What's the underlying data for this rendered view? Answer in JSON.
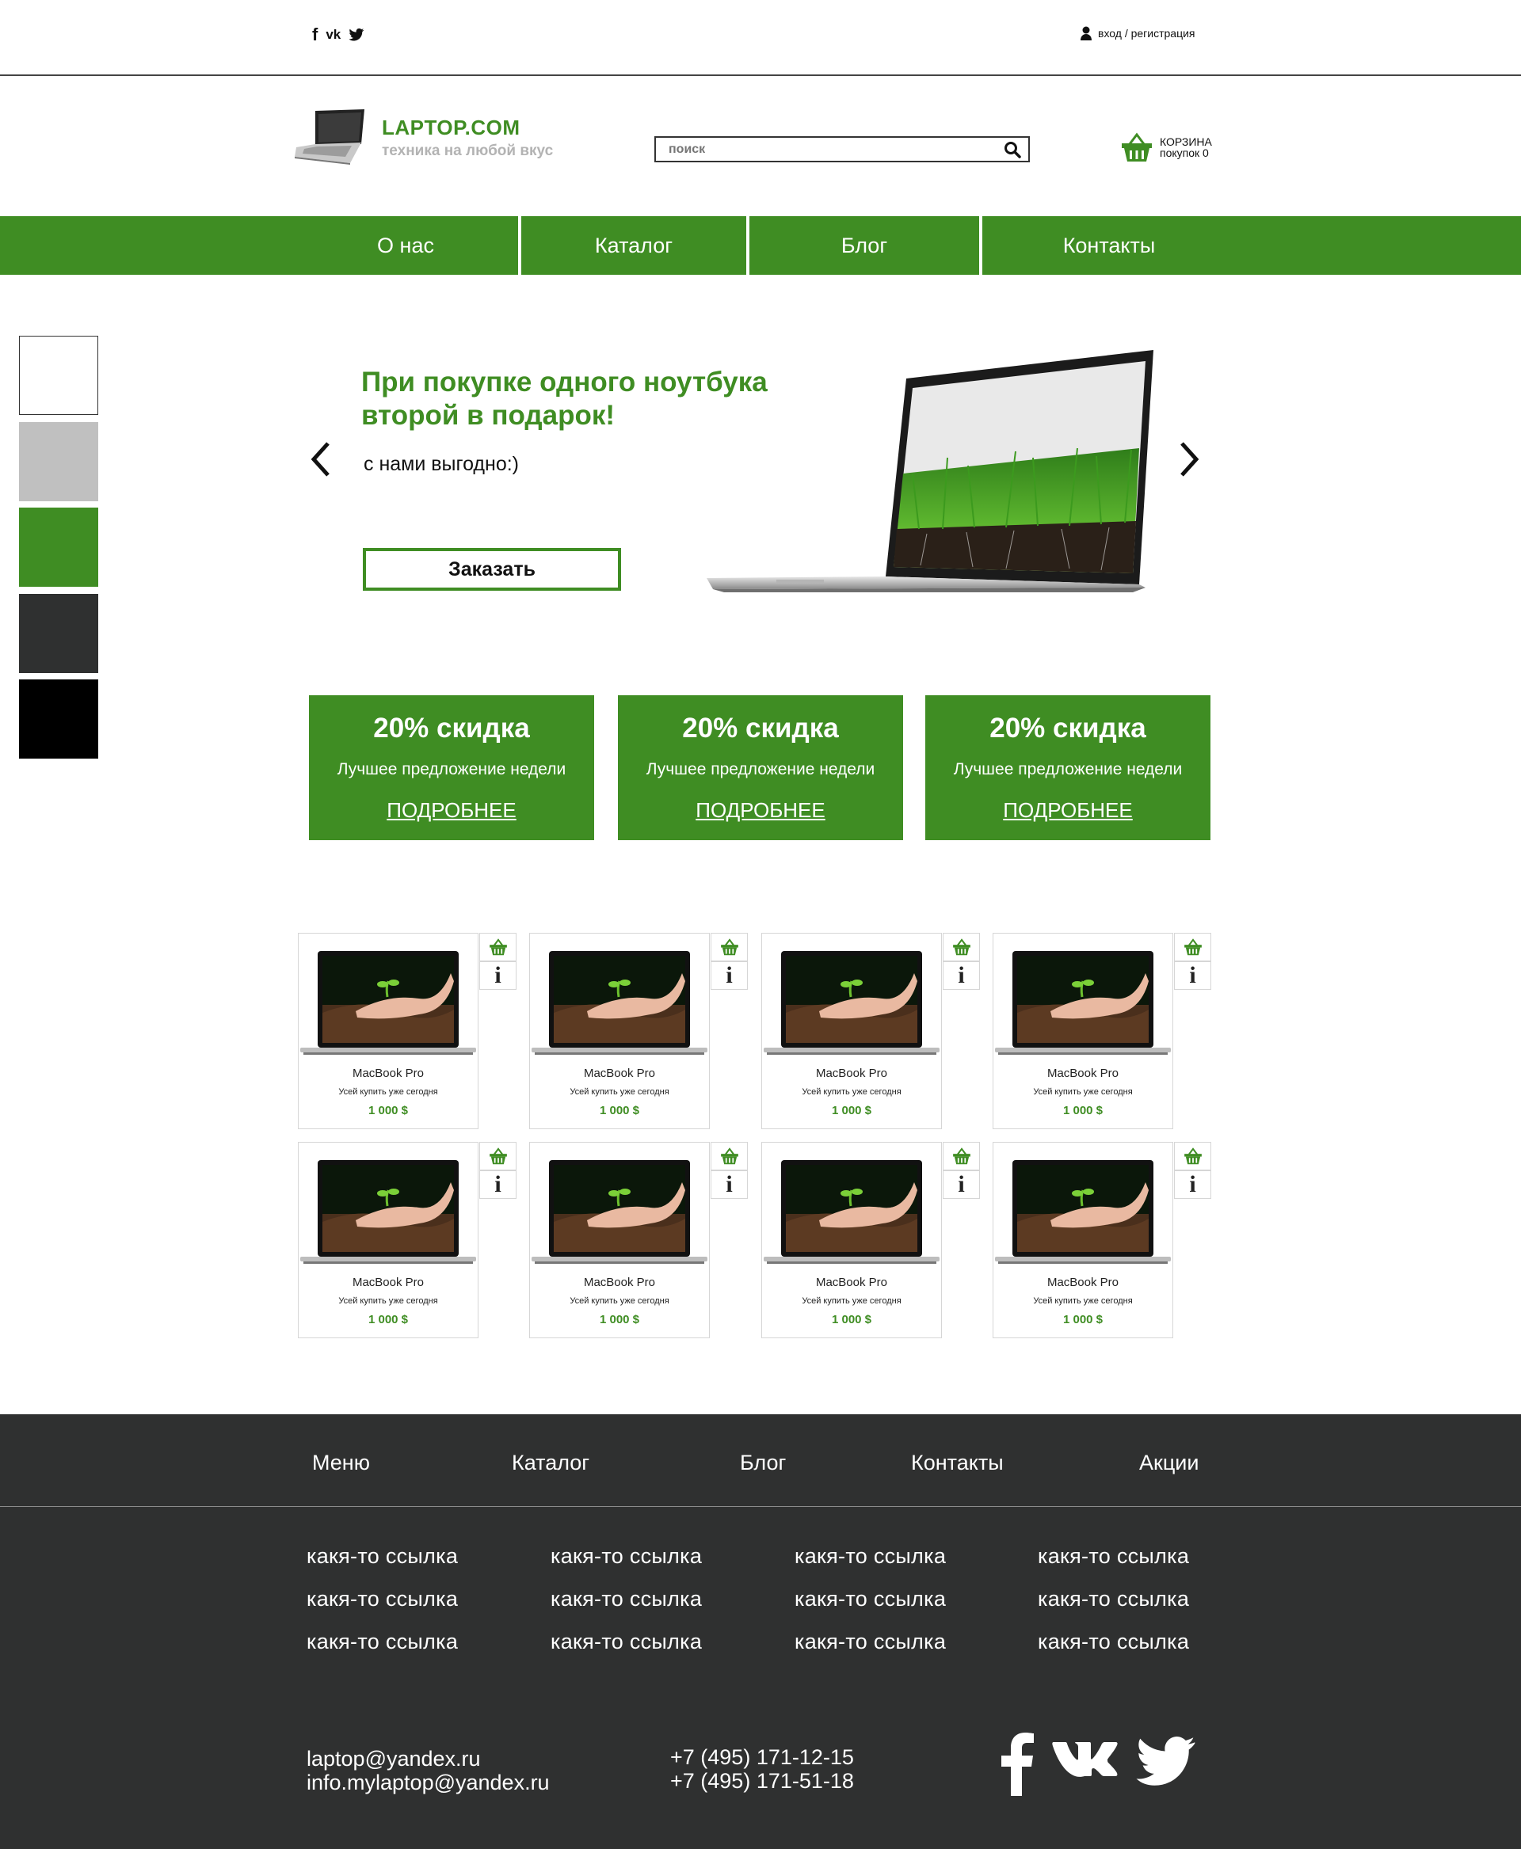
{
  "topbar": {
    "social_icons": [
      "facebook-icon",
      "vk-icon",
      "twitter-icon"
    ],
    "social_glyphs": [
      "f",
      "vk",
      "t"
    ],
    "login_label": "вход / регистрация"
  },
  "header": {
    "logo_title": "LAPTOP.COM",
    "logo_subtitle": "техника на любой вкус",
    "search_placeholder": "поиск",
    "cart_title": "КОРЗИНА",
    "cart_count_label": "покупок 0"
  },
  "nav": {
    "items": [
      {
        "label": "О нас"
      },
      {
        "label": "Каталог"
      },
      {
        "label": "Блог"
      },
      {
        "label": "Контакты"
      }
    ]
  },
  "colors": {
    "accent": "#3f8d23",
    "swatches": [
      "#ffffff",
      "#c0c0c0",
      "#3f8d23",
      "#2f3030",
      "#000000"
    ],
    "footer_bg": "#2f3030"
  },
  "hero": {
    "title_line1": "При покупке одного ноутбука",
    "title_line2": "второй в подарок!",
    "subtitle": "с нами выгодно:)",
    "button_label": "Заказать"
  },
  "promos": [
    {
      "title": "20% скидка",
      "subtitle": "Лучшее предложение недели",
      "link": "ПОДРОБНЕЕ"
    },
    {
      "title": "20% скидка",
      "subtitle": "Лучшее предложение недели",
      "link": "ПОДРОБНЕЕ"
    },
    {
      "title": "20% скидка",
      "subtitle": "Лучшее предложение недели",
      "link": "ПОДРОБНЕЕ"
    }
  ],
  "products": [
    {
      "name": "MacBook Pro",
      "desc": "Усей купить уже сегодня",
      "price": "1 000 $",
      "info": "i"
    },
    {
      "name": "MacBook Pro",
      "desc": "Усей купить уже сегодня",
      "price": "1 000 $",
      "info": "i"
    },
    {
      "name": "MacBook Pro",
      "desc": "Усей купить уже сегодня",
      "price": "1 000 $",
      "info": "i"
    },
    {
      "name": "MacBook Pro",
      "desc": "Усей купить уже сегодня",
      "price": "1 000 $",
      "info": "i"
    },
    {
      "name": "MacBook Pro",
      "desc": "Усей купить уже сегодня",
      "price": "1 000 $",
      "info": "i"
    },
    {
      "name": "MacBook Pro",
      "desc": "Усей купить уже сегодня",
      "price": "1 000 $",
      "info": "i"
    },
    {
      "name": "MacBook Pro",
      "desc": "Усей купить уже сегодня",
      "price": "1 000 $",
      "info": "i"
    },
    {
      "name": "MacBook Pro",
      "desc": "Усей купить уже сегодня",
      "price": "1 000 $",
      "info": "i"
    }
  ],
  "footer": {
    "menu": [
      "Меню",
      "Каталог",
      "Блог",
      "Контакты",
      "Акции"
    ],
    "links": [
      [
        "какя-то ссылка",
        "какя-то ссылка",
        "какя-то ссылка"
      ],
      [
        "какя-то ссылка",
        "какя-то ссылка",
        "какя-то ссылка"
      ],
      [
        "какя-то ссылка",
        "какя-то ссылка",
        "какя-то ссылка"
      ],
      [
        "какя-то ссылка",
        "какя-то ссылка",
        "какя-то ссылка"
      ]
    ],
    "emails": [
      "laptop@yandex.ru",
      "info.mylaptop@yandex.ru"
    ],
    "phones": [
      "+7 (495) 171-12-15",
      "+7 (495) 171-51-18"
    ],
    "social_icons": [
      "facebook-icon",
      "vk-icon",
      "twitter-icon"
    ]
  }
}
